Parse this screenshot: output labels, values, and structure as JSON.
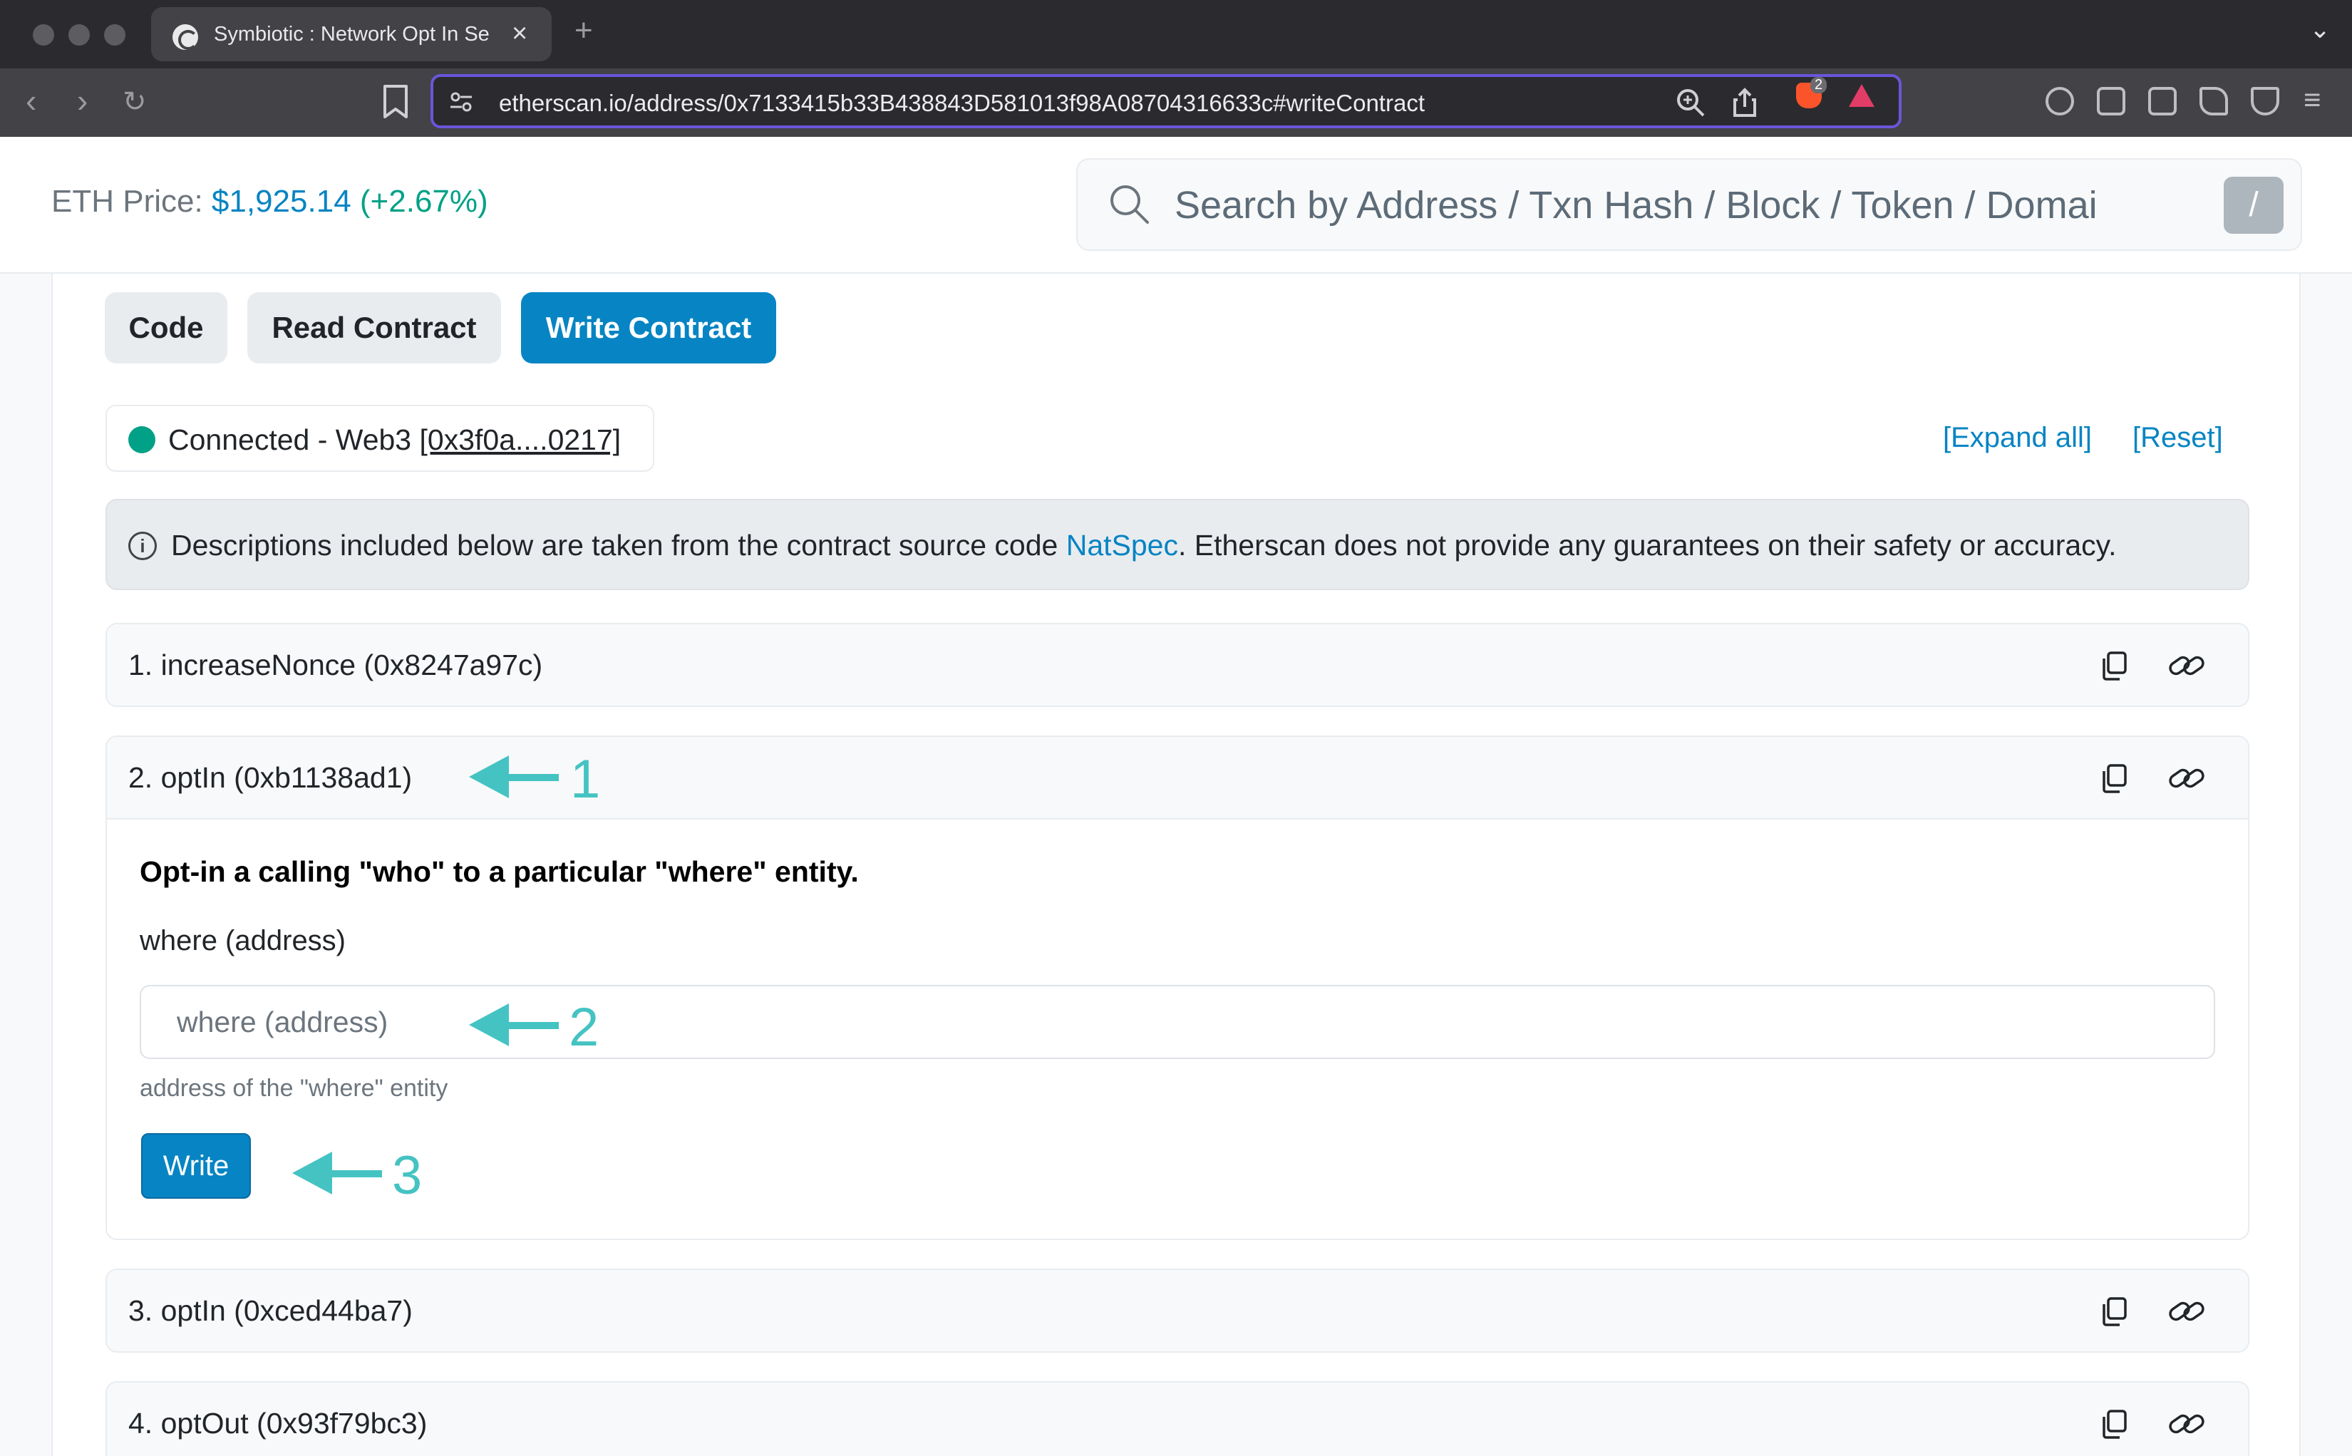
{
  "browser": {
    "tab_title": "Symbiotic : Network Opt In Se",
    "url": "etherscan.io/address/0x7133415b33B438843D581013f98A08704316633c#writeContract",
    "shield_count": "2"
  },
  "header": {
    "eth_price_label": "ETH Price: ",
    "eth_price_value": "$1,925.14",
    "eth_price_change": "(+2.67%)",
    "search_placeholder": "Search by Address / Txn Hash / Block / Token / Domai",
    "search_shortcut": "/"
  },
  "tabs": [
    {
      "label": "Code"
    },
    {
      "label": "Read Contract"
    },
    {
      "label": "Write Contract"
    }
  ],
  "connection": {
    "status_text": "Connected - Web3 ",
    "address": "[0x3f0a....0217]",
    "status_color": "#00a186"
  },
  "actions": {
    "expand_all": "[Expand all]",
    "reset": "[Reset]"
  },
  "notice": {
    "text_before": "Descriptions included below are taken from the contract source code ",
    "natspec_link": "NatSpec",
    "text_after": ". Etherscan does not provide any guarantees on their safety or accuracy."
  },
  "methods": [
    {
      "title": "1. increaseNonce (0x8247a97c)",
      "expanded": false
    },
    {
      "title": "2. optIn (0xb1138ad1)",
      "expanded": true,
      "description": "Opt-in a calling \"who\" to a particular \"where\" entity.",
      "field_label": "where (address)",
      "field_placeholder": "where (address)",
      "field_hint": "address of the \"where\" entity",
      "write_label": "Write"
    },
    {
      "title": "3. optIn (0xced44ba7)",
      "expanded": false
    },
    {
      "title": "4. optOut (0x93f79bc3)",
      "expanded": false
    }
  ],
  "annotations": [
    "1",
    "2",
    "3"
  ],
  "colors": {
    "accent": "#0784c3",
    "annotation": "#45c3c3",
    "success": "#00a186"
  }
}
